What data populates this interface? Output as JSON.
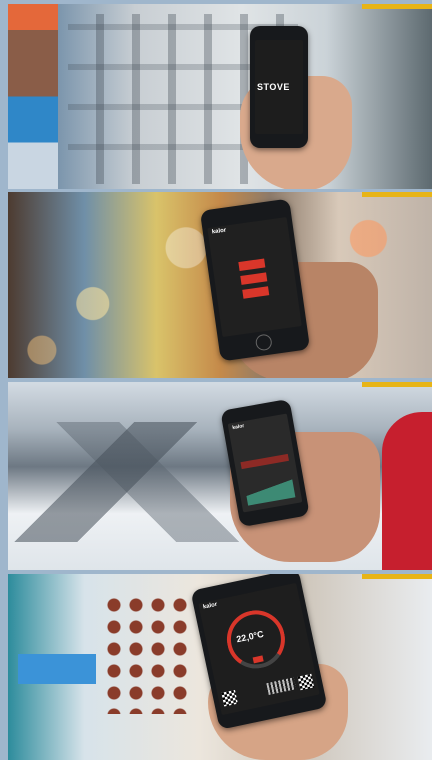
{
  "colors": {
    "accent": "#e7b417",
    "app_red": "#d9362a"
  },
  "panels": [
    {
      "scene": "street",
      "brand_text": "STOVE"
    },
    {
      "scene": "crowd",
      "header_text": "kalor",
      "button_count": 3
    },
    {
      "scene": "mountains",
      "header_text": "kalor"
    },
    {
      "scene": "desk",
      "header_text": "kalor",
      "temperature": "22,0°C"
    }
  ]
}
